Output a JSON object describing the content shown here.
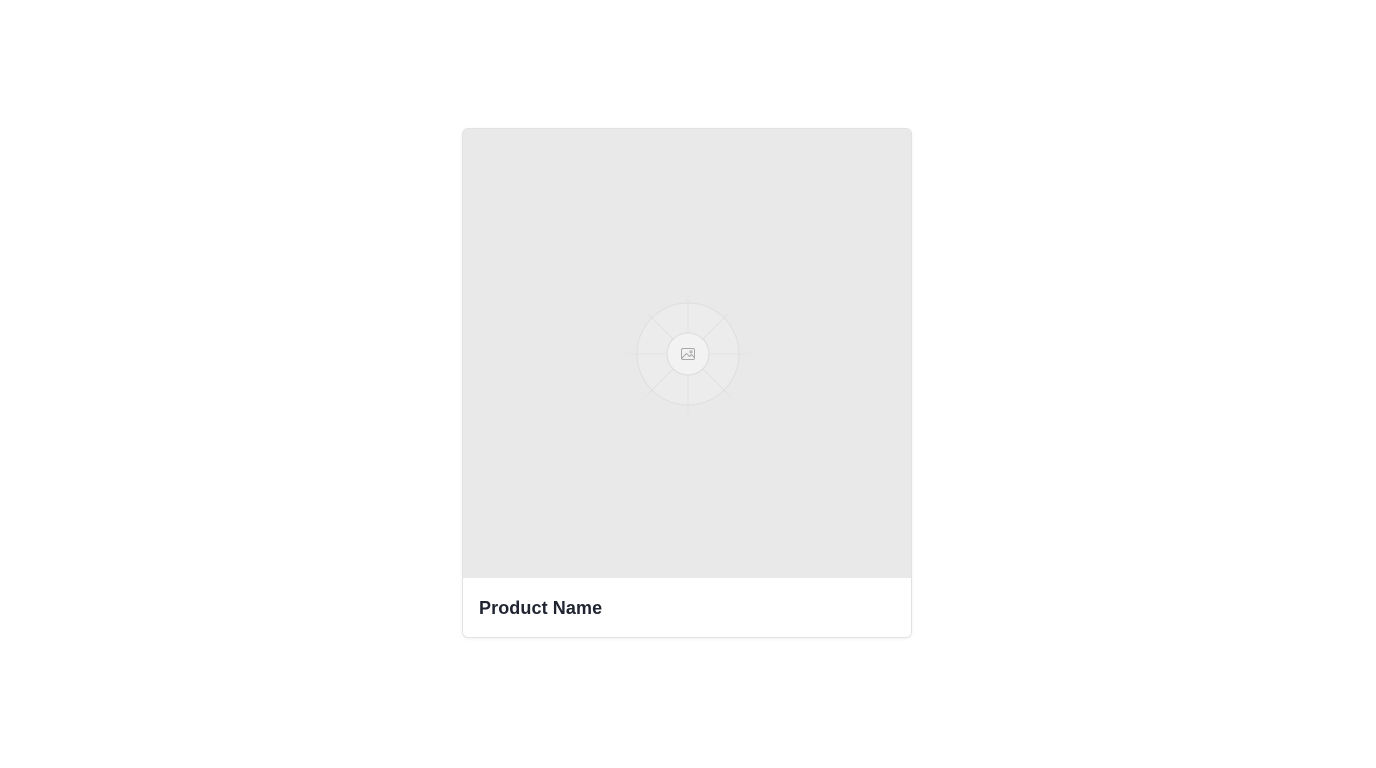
{
  "product_card": {
    "name": "Product Name",
    "image": {
      "placeholder_icon": "image-icon",
      "background_color": "#e9e9e9"
    }
  },
  "colors": {
    "page_background": "#ffffff",
    "card_border": "#e2e2e2",
    "title_text": "#1f2430",
    "placeholder_icon": "#a8a8a8"
  }
}
